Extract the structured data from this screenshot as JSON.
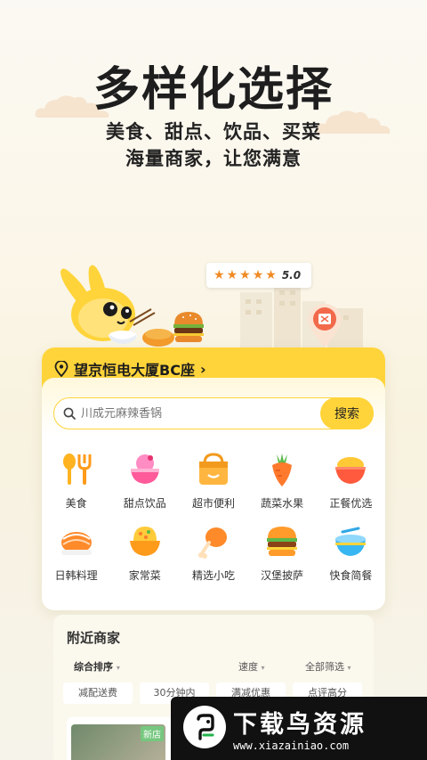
{
  "hero": {
    "title": "多样化选择",
    "subtitle_line1": "美食、甜点、饮品、买菜",
    "subtitle_line2": "海量商家，让您满意"
  },
  "rating": {
    "stars": 5,
    "value": "5.0"
  },
  "card": {
    "location": "望京恒电大厦BC座",
    "location_chevron": "›",
    "search": {
      "placeholder": "川成元麻辣香锅",
      "button": "搜索"
    },
    "categories": [
      {
        "label": "美食",
        "icon": "fork-spoon-icon"
      },
      {
        "label": "甜点饮品",
        "icon": "dessert-bowl-icon"
      },
      {
        "label": "超市便利",
        "icon": "shopping-basket-icon"
      },
      {
        "label": "蔬菜水果",
        "icon": "carrot-icon"
      },
      {
        "label": "正餐优选",
        "icon": "rice-bowl-icon"
      },
      {
        "label": "日韩料理",
        "icon": "sushi-icon"
      },
      {
        "label": "家常菜",
        "icon": "fried-rice-icon"
      },
      {
        "label": "精选小吃",
        "icon": "drumstick-icon"
      },
      {
        "label": "汉堡披萨",
        "icon": "burger-icon"
      },
      {
        "label": "快食简餐",
        "icon": "bento-icon"
      }
    ]
  },
  "nearby": {
    "title": "附近商家",
    "sort": {
      "default": "综合排序",
      "speed": "速度",
      "filter": "全部筛选"
    },
    "chips": [
      "减配送费",
      "30分钟内",
      "满减优惠",
      "点评高分"
    ],
    "shop_badge": "新店"
  },
  "watermark": {
    "title": "下载鸟资源",
    "url": "www.xiazainiao.com"
  },
  "colors": {
    "accent": "#ffd43a",
    "star": "#f08a24",
    "bg": "#fbf6e8"
  }
}
